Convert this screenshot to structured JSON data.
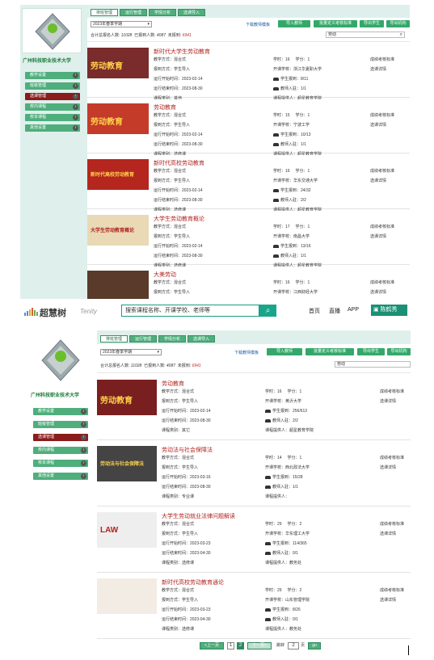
{
  "shot1": {
    "school_name": "广州科技职业技术大学",
    "nav": [
      "教学设置",
      "班级管理",
      "选课管理",
      "校内课程",
      "校本课程",
      "其他设置"
    ],
    "tabs": [
      "排班管理",
      "运行管理",
      "学情分析",
      "选课导入"
    ],
    "term": "2023年春季学期",
    "download_link": "下载教师模板",
    "buttons": [
      "导入教师",
      "批量定义考核标准",
      "导出学生",
      "导出机构"
    ],
    "stats": {
      "label1": "合计总报名人数:",
      "v1": "11028",
      "label2": "已报到人数:",
      "v2": "4087",
      "label3": "未报到:",
      "v3": "6941"
    },
    "search_value": "劳动",
    "courses": [
      {
        "title": "新时代大学生劳动教育",
        "mode": "教学方式：混合式",
        "report": "报到方式：学生导入",
        "start": "运行开始时间：2023-02-14",
        "end": "运行结束时间：2023-08-30",
        "cat": "课程类别：其他",
        "hours": "学时：16",
        "credit": "学分：1",
        "school": "开课学校：浙江华夏职大学",
        "enroll": "学生报到：8/11",
        "teachers": "教师入驻：1/1",
        "provider": "课程提供人：超星教育学院",
        "r1": "成绩考核标准",
        "r2": "选课详情",
        "thumb": "劳动教育",
        "thumb_bg": "#7a2b2b"
      },
      {
        "title": "劳动教育",
        "mode": "教学方式：混合式",
        "report": "报到方式：学生导入",
        "start": "运行开始时间：2023-02-14",
        "end": "运行结束时间：2023-08-30",
        "cat": "课程类别：选修课",
        "hours": "学时：15",
        "credit": "学分：1",
        "school": "开课学校：宁波工学",
        "enroll": "学生报到：10/13",
        "teachers": "教师入驻：1/1",
        "provider": "课程提供人：超星教育学院",
        "r1": "成绩考核标准",
        "r2": "选课详情",
        "thumb": "劳动教育",
        "thumb_bg": "#c43b2a"
      },
      {
        "title": "新时代高校劳动教育",
        "mode": "教学方式：混合式",
        "report": "报到方式：学生导入",
        "start": "运行开始时间：2023-02-14",
        "end": "运行结束时间：2023-08-30",
        "cat": "课程类别：选修课",
        "hours": "学时：16",
        "credit": "学分：1",
        "school": "开课学校：华东交通大学",
        "enroll": "学生报到：24/32",
        "teachers": "教师入驻：2/2",
        "provider": "课程提供人：超星教育学院",
        "r1": "成绩考核标准",
        "r2": "选课详情",
        "thumb": "新时代高校劳动教育",
        "thumb_bg": "#b5261f"
      },
      {
        "title": "大学生劳动教育概论",
        "mode": "教学方式：混合式",
        "report": "报到方式：学生导入",
        "start": "运行开始时间：2023-02-14",
        "end": "运行结束时间：2023-08-30",
        "cat": "课程类别：选修课",
        "hours": "学时：17",
        "credit": "学分：1",
        "school": "开课学校：南昌大学",
        "enroll": "学生报到：13/16",
        "teachers": "教师入驻：1/1",
        "provider": "课程提供人：超星教育学院",
        "r1": "成绩考核标准",
        "r2": "选课详情",
        "thumb": "大学生劳动教育概论",
        "thumb_bg": "#e9d9b5"
      },
      {
        "title": "大美劳动",
        "mode": "教学方式：混合式",
        "report": "报到方式：学生导入",
        "start": "运行开始时间：2023-02-14",
        "end": "",
        "cat": "",
        "hours": "学时：16",
        "credit": "学分：1",
        "school": "开课学校：江西财经大学",
        "enroll": "学生报到：27/35",
        "teachers": "",
        "provider": "",
        "r1": "成绩考核标准",
        "r2": "选课详情",
        "thumb": "",
        "thumb_bg": "#5a3a2a"
      }
    ]
  },
  "topbar": {
    "brand": "超慧树",
    "brand_en": "Tenity",
    "search_placeholder": "搜索课程名称、开课学校、老师等",
    "search_icon": "search-icon",
    "links": [
      "首页",
      "直播",
      "APP"
    ],
    "user": "陈鹤秀"
  },
  "shot2": {
    "school_name": "广州科技职业技术大学",
    "nav": [
      "教学设置",
      "班级管理",
      "选课管理",
      "校内课程",
      "校本课程",
      "其他设置"
    ],
    "tabs": [
      "排班管理",
      "运行管理",
      "学情分析",
      "选课导入"
    ],
    "term": "2023年春季学期",
    "download_link": "下载教师模板",
    "buttons": [
      "导入教师",
      "批量定义考核标准",
      "导出学生",
      "导出机构"
    ],
    "stats": {
      "label1": "合计总报名人数:",
      "v1": "11028",
      "label2": "已报到人数:",
      "v2": "4087",
      "label3": "未报到:",
      "v3": "6941"
    },
    "search_value": "劳动",
    "courses": [
      {
        "title": "劳动教育",
        "mode": "教学方式：混合式",
        "report": "报到方式：学生导入",
        "start": "运行开始时间：2023-02-14",
        "end": "运行结束时间：2023-08-30",
        "cat": "课程类别：其它",
        "hours": "学时：16",
        "credit": "学分：1",
        "school": "开课学校：黄沂大学",
        "enroll": "学生报到：256/613",
        "teachers": "教师入驻：2/2",
        "provider": "课程提供人：超星教育学院",
        "r1": "成绩考核标准",
        "r2": "选课详情",
        "thumb": "劳动教育",
        "thumb_bg": "#7a1f1f"
      },
      {
        "title": "劳动法与社会保障法",
        "mode": "教学方式：混合式",
        "report": "报到方式：学生导入",
        "start": "运行开始时间：2023-03-16",
        "end": "运行结束时间：2023-08-30",
        "cat": "课程类别：专业课",
        "hours": "学时：14",
        "credit": "学分：1",
        "school": "开课学校：西北政法大学",
        "enroll": "学生报到：15/28",
        "teachers": "教师入驻：1/1",
        "provider": "课程提供人：",
        "r1": "成绩考核标准",
        "r2": "选课详情",
        "thumb": "劳动法与社会保障法",
        "thumb_bg": "#444"
      },
      {
        "title": "大学生劳动就业法律问题解读",
        "mode": "教学方式：混合式",
        "report": "报到方式：学生导入",
        "start": "运行开始时间：2023-03-23",
        "end": "运行结束时间：2023-04-30",
        "cat": "课程类别：选修课",
        "hours": "学时：29",
        "credit": "学分：2",
        "school": "开课学校：华东理工大学",
        "enroll": "学生报到：114/365",
        "teachers": "教师入驻：0/1",
        "provider": "课程提供人：教务处",
        "r1": "成绩考核标准",
        "r2": "选课详情",
        "thumb": "LAW",
        "thumb_bg": "#eee"
      },
      {
        "title": "新时代高校劳动教育通论",
        "mode": "教学方式：混合式",
        "report": "报到方式：学生导入",
        "start": "运行开始时间：2023-03-23",
        "end": "运行结束时间：2023-04-30",
        "cat": "课程类别：选修课",
        "hours": "学时：29",
        "credit": "学分：2",
        "school": "开课学校：山东管理学院",
        "enroll": "学生报到：8/26",
        "teachers": "教师入驻：0/1",
        "provider": "课程提供人：教务处",
        "r1": "成绩考核标准",
        "r2": "选课详情",
        "thumb": "",
        "thumb_bg": "#f3ece4"
      }
    ],
    "pager": {
      "prev": "<上一页",
      "p1": "1",
      "p2": "2",
      "next": "下一页>",
      "jump": "跳转",
      "page_unit": "页",
      "page_input": "2",
      "go": "go"
    }
  }
}
